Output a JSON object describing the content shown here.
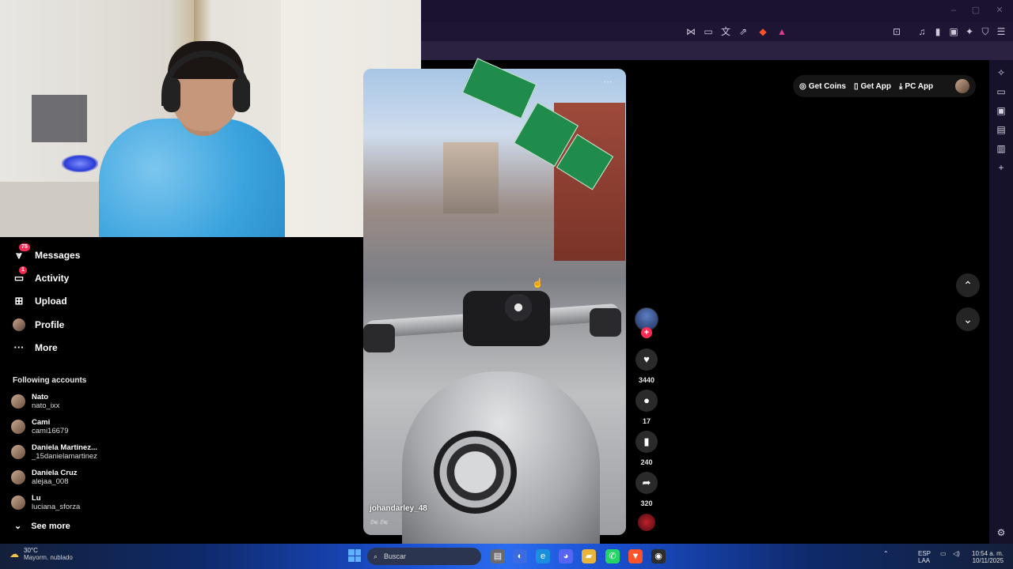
{
  "window": {
    "minimize": "–",
    "maximize": "▢",
    "close": "✕"
  },
  "left_nav": {
    "items": [
      {
        "key": "messages",
        "label": "Messages",
        "icon": "send-icon",
        "badge": "75"
      },
      {
        "key": "activity",
        "label": "Activity",
        "icon": "activity-icon",
        "badge": "1"
      },
      {
        "key": "upload",
        "label": "Upload",
        "icon": "plus-square-icon",
        "badge": ""
      },
      {
        "key": "profile",
        "label": "Profile",
        "icon": "avatar-icon",
        "badge": ""
      },
      {
        "key": "more",
        "label": "More",
        "icon": "ellipsis-icon",
        "badge": ""
      }
    ],
    "following_title": "Following accounts",
    "accounts": [
      {
        "name": "Nato",
        "handle": "nato_ixx"
      },
      {
        "name": "Cami",
        "handle": "cami16679"
      },
      {
        "name": "Daniela Martinez...",
        "handle": "_15danielamartinez"
      },
      {
        "name": "Daniela Cruz",
        "handle": "alejaa_008"
      },
      {
        "name": "Lu",
        "handle": "luciana_sforza"
      }
    ],
    "see_more": "See more"
  },
  "video": {
    "username": "johandarley_48",
    "caption_emoji": "🏍 🏍"
  },
  "actions": {
    "likes": "3440",
    "comments": "17",
    "saves": "240",
    "shares": "320"
  },
  "top_bar": {
    "get_coins": "Get Coins",
    "get_app": "Get App",
    "pc_app": "PC App"
  },
  "taskbar": {
    "temperature": "30°C",
    "weather": "Mayorm. nublado",
    "search_placeholder": "Buscar",
    "lang": "ESP",
    "lang_sub": "LAA",
    "time": "10:54 a. m.",
    "date": "10/11/2025"
  },
  "colors": {
    "accent": "#fe2c55",
    "browser_chrome": "#1b1230"
  }
}
